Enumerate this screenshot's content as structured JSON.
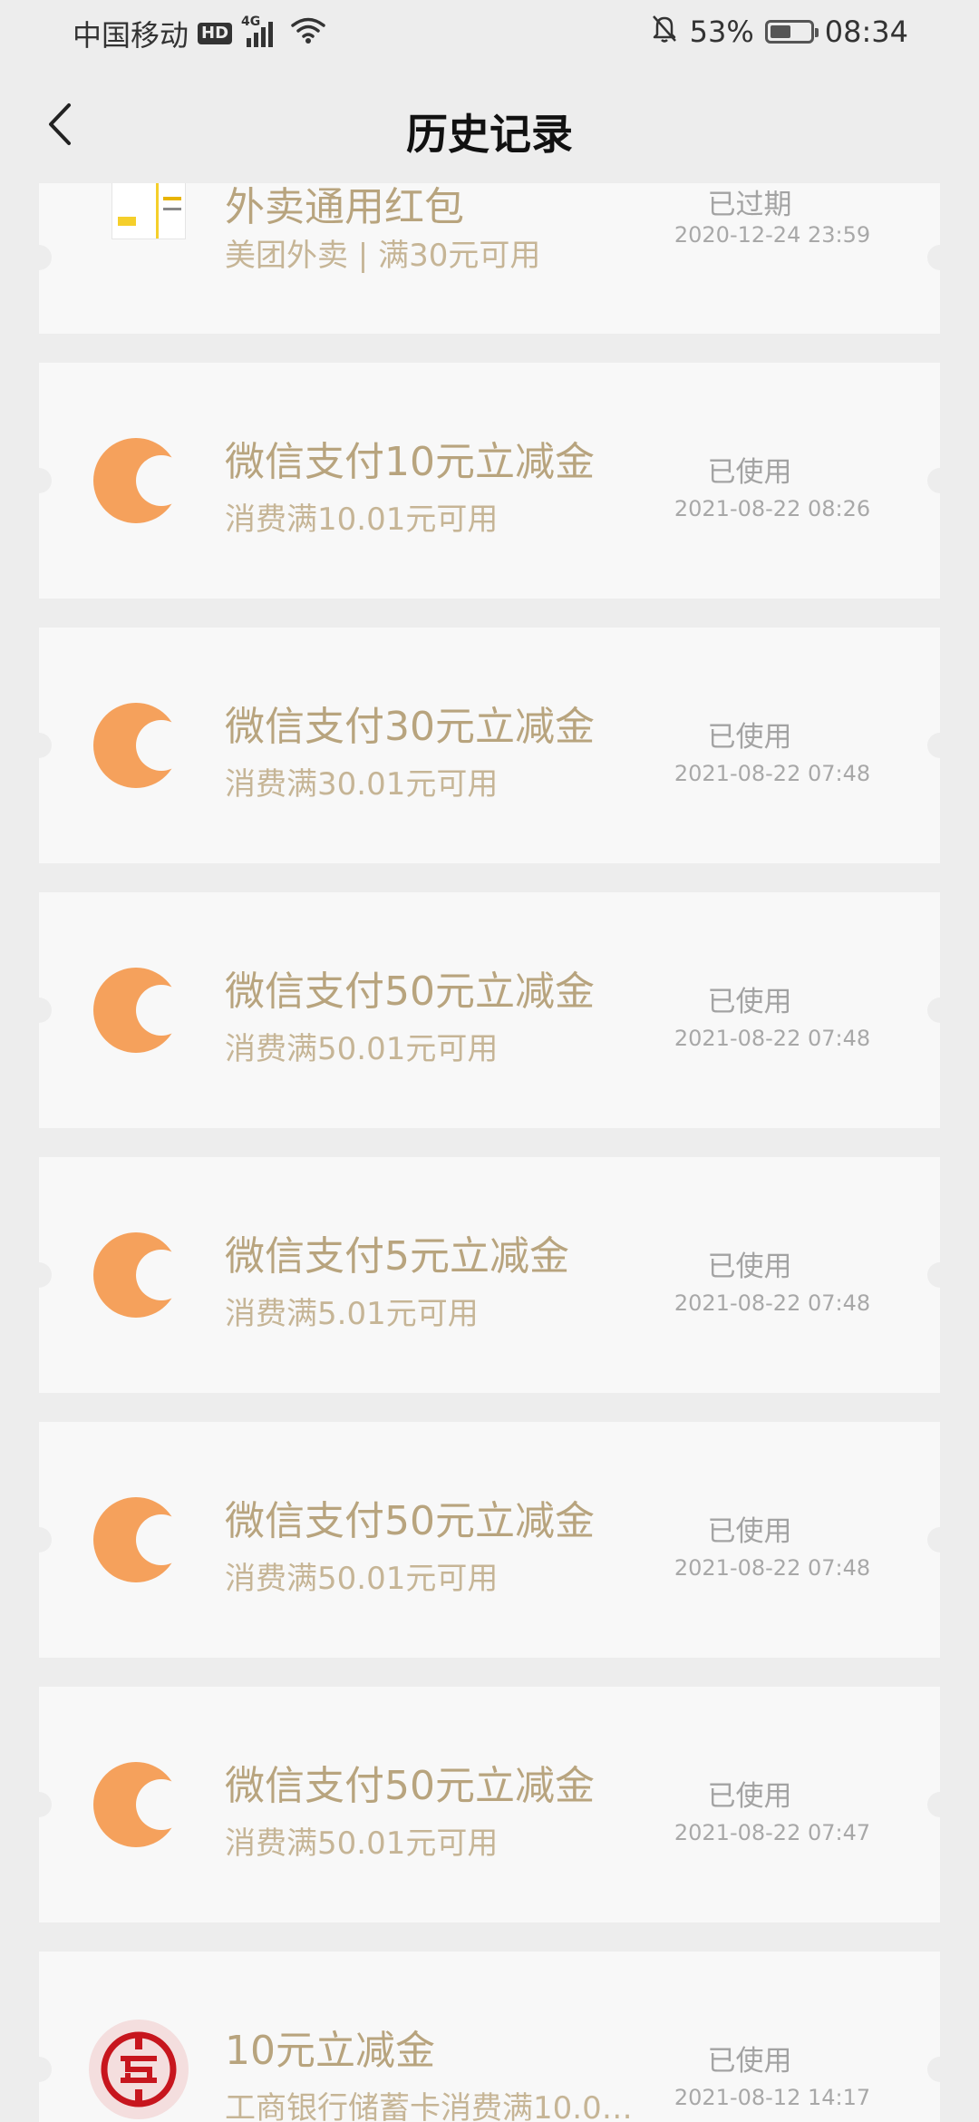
{
  "status_bar": {
    "carrier": "中国移动",
    "hd": "HD",
    "network": "4G",
    "battery_percent": "53%",
    "battery_level": 0.53,
    "time": "08:34"
  },
  "nav": {
    "title": "历史记录"
  },
  "colors": {
    "accent_orange": "#f5a15c",
    "title_gold": "#b8a47e",
    "background": "#ededed",
    "card": "#f8f8f8"
  },
  "coupons": [
    {
      "icon": "meituan-coupon-icon",
      "title": "外卖通用红包",
      "subtitle": "美团外卖 | 满30元可用",
      "status": "已过期",
      "time": "2020-12-24 23:59"
    },
    {
      "icon": "wechat-pay-coupon-icon",
      "title": "微信支付10元立减金",
      "subtitle": "消费满10.01元可用",
      "status": "已使用",
      "time": "2021-08-22 08:26"
    },
    {
      "icon": "wechat-pay-coupon-icon",
      "title": "微信支付30元立减金",
      "subtitle": "消费满30.01元可用",
      "status": "已使用",
      "time": "2021-08-22 07:48"
    },
    {
      "icon": "wechat-pay-coupon-icon",
      "title": "微信支付50元立减金",
      "subtitle": "消费满50.01元可用",
      "status": "已使用",
      "time": "2021-08-22 07:48"
    },
    {
      "icon": "wechat-pay-coupon-icon",
      "title": "微信支付5元立减金",
      "subtitle": "消费满5.01元可用",
      "status": "已使用",
      "time": "2021-08-22 07:48"
    },
    {
      "icon": "wechat-pay-coupon-icon",
      "title": "微信支付50元立减金",
      "subtitle": "消费满50.01元可用",
      "status": "已使用",
      "time": "2021-08-22 07:48"
    },
    {
      "icon": "wechat-pay-coupon-icon",
      "title": "微信支付50元立减金",
      "subtitle": "消费满50.01元可用",
      "status": "已使用",
      "time": "2021-08-22 07:47"
    },
    {
      "icon": "icbc-bank-icon",
      "title": "10元立减金",
      "subtitle": "工商银行储蓄卡消费满10.0…",
      "status": "已使用",
      "time": "2021-08-12 14:17"
    }
  ]
}
